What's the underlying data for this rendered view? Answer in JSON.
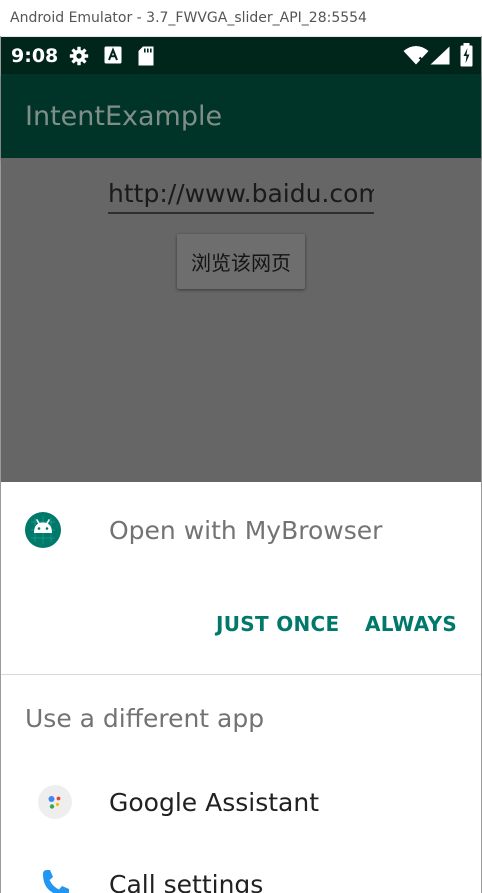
{
  "window": {
    "title": "Android Emulator - 3.7_FWVGA_slider_API_28:5554"
  },
  "status_bar": {
    "time": "9:08",
    "icons": [
      "gear-icon",
      "a-icon",
      "sd-card-icon",
      "wifi-icon",
      "signal-icon",
      "battery-icon"
    ]
  },
  "app_bar": {
    "title": "IntentExample"
  },
  "content": {
    "url_value": "http://www.baidu.com",
    "browse_button_label": "浏览该网页"
  },
  "chooser": {
    "open_with_label": "Open with MyBrowser",
    "just_once_label": "JUST ONCE",
    "always_label": "ALWAYS",
    "different_app_header": "Use a different app",
    "apps": [
      {
        "label": "Google Assistant",
        "icon": "google-assistant-icon"
      },
      {
        "label": "Call settings",
        "icon": "phone-icon"
      }
    ]
  },
  "colors": {
    "status_bar": "#00251a",
    "app_bar_dimmed": "#003428",
    "scrim_content": "#666666",
    "accent": "#00796b",
    "android_icon_bg": "#00796b"
  }
}
